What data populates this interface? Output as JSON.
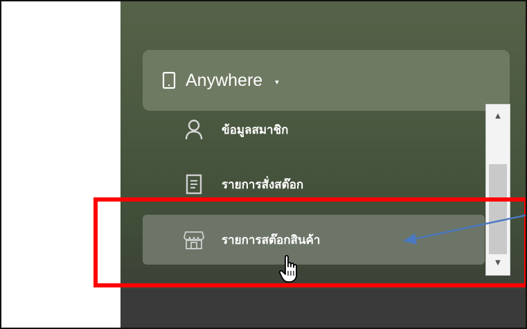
{
  "dropdown": {
    "title": "Anywhere",
    "icon": "phone-icon",
    "caret": "▾"
  },
  "menu": {
    "items": [
      {
        "label": "ข้อมูลสมาชิก",
        "icon": "user-icon"
      },
      {
        "label": "รายการสั่งสต๊อก",
        "icon": "document-icon"
      },
      {
        "label": "รายการสต๊อกสินค้า",
        "icon": "store-icon",
        "active": true
      }
    ]
  },
  "scrollbar": {
    "up": "▲",
    "down": "▼"
  },
  "annotations": {
    "highlight_color": "#ff0000",
    "arrow_color": "#4a78c2",
    "cursor": "hand-pointer-icon"
  }
}
